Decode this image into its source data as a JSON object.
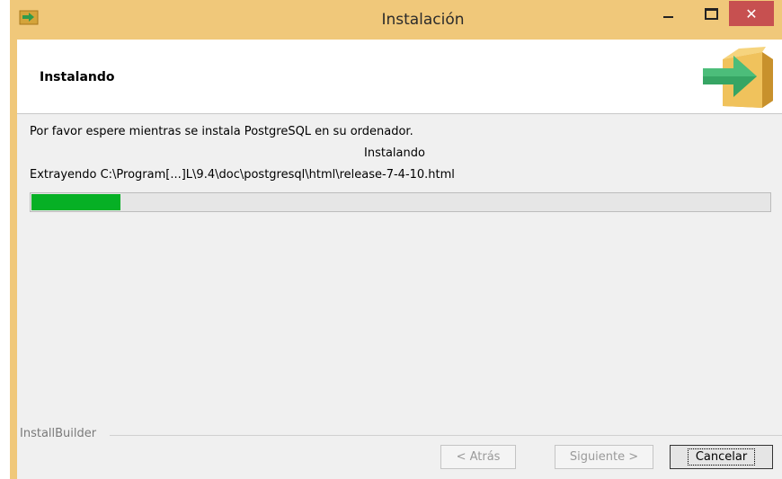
{
  "window": {
    "title": "Instalación",
    "close_glyph": "✕"
  },
  "header": {
    "title": "Instalando",
    "icon": "box-arrow-icon"
  },
  "main": {
    "message": "Por favor espere mientras se instala PostgreSQL en su ordenador.",
    "status": "Instalando",
    "detail": "Extrayendo C:\\Program[...]L\\9.4\\doc\\postgresql\\html\\release-7-4-10.html",
    "progress_fraction": 0.12,
    "progress_color": "#06b025"
  },
  "footer": {
    "brand": "InstallBuilder",
    "back_label": "< Atrás",
    "next_label": "Siguiente >",
    "cancel_label": "Cancelar"
  }
}
